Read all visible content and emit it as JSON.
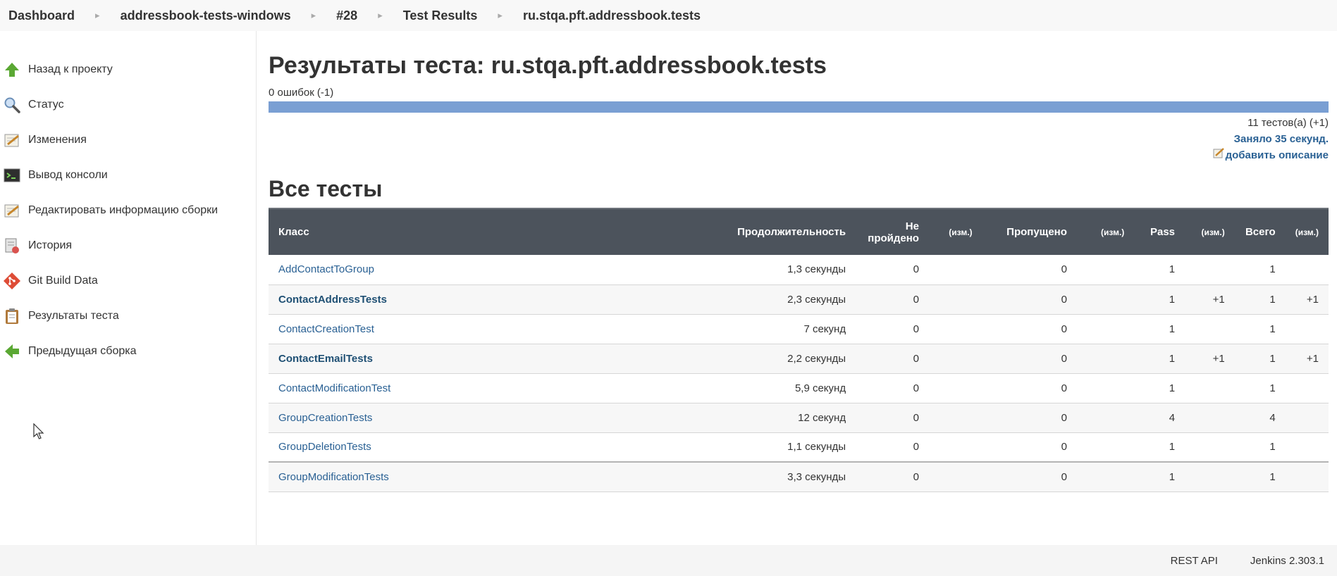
{
  "breadcrumbs": [
    {
      "label": "Dashboard"
    },
    {
      "label": "addressbook-tests-windows"
    },
    {
      "label": "#28"
    },
    {
      "label": "Test Results"
    },
    {
      "label": "ru.stqa.pft.addressbook.tests"
    }
  ],
  "sidebar": {
    "items": [
      {
        "label": "Назад к проекту",
        "icon": "arrow-up-icon"
      },
      {
        "label": "Статус",
        "icon": "magnifier-icon"
      },
      {
        "label": "Изменения",
        "icon": "notepad-icon"
      },
      {
        "label": "Вывод консоли",
        "icon": "terminal-icon"
      },
      {
        "label": "Редактировать информацию сборки",
        "icon": "notepad-icon"
      },
      {
        "label": "История",
        "icon": "history-icon"
      },
      {
        "label": "Git Build Data",
        "icon": "git-icon"
      },
      {
        "label": "Результаты теста",
        "icon": "clipboard-icon"
      },
      {
        "label": "Предыдущая сборка",
        "icon": "arrow-left-icon"
      }
    ]
  },
  "main": {
    "title": "Результаты теста: ru.stqa.pft.addressbook.tests",
    "failures": "0 ошибок (-1)",
    "progress_pass_fraction": 1.0,
    "tests_count": "11 тестов(а) (+1)",
    "duration": "Заняло 35 секунд.",
    "add_description": "добавить описание",
    "all_tests_title": "Все тесты"
  },
  "table": {
    "headers": {
      "class": "Класс",
      "duration": "Продолжительность",
      "failed": "Не пройдено",
      "change1": "(изм.)",
      "skipped": "Пропущено",
      "change2": "(изм.)",
      "pass": "Pass",
      "change3": "(изм.)",
      "total": "Всего",
      "change4": "(изм.)"
    },
    "rows": [
      {
        "cls": "AddContactToGroup",
        "duration": "1,3 секунды",
        "failed": "0",
        "fail_diff": "",
        "skipped": "0",
        "skip_diff": "",
        "pass": "1",
        "pass_diff": "",
        "total": "1",
        "total_diff": ""
      },
      {
        "cls": "ContactAddressTests",
        "duration": "2,3 секунды",
        "failed": "0",
        "fail_diff": "",
        "skipped": "0",
        "skip_diff": "",
        "pass": "1",
        "pass_diff": "+1",
        "total": "1",
        "total_diff": "+1"
      },
      {
        "cls": "ContactCreationTest",
        "duration": "7 секунд",
        "failed": "0",
        "fail_diff": "",
        "skipped": "0",
        "skip_diff": "",
        "pass": "1",
        "pass_diff": "",
        "total": "1",
        "total_diff": ""
      },
      {
        "cls": "ContactEmailTests",
        "duration": "2,2 секунды",
        "failed": "0",
        "fail_diff": "",
        "skipped": "0",
        "skip_diff": "",
        "pass": "1",
        "pass_diff": "+1",
        "total": "1",
        "total_diff": "+1"
      },
      {
        "cls": "ContactModificationTest",
        "duration": "5,9 секунд",
        "failed": "0",
        "fail_diff": "",
        "skipped": "0",
        "skip_diff": "",
        "pass": "1",
        "pass_diff": "",
        "total": "1",
        "total_diff": ""
      },
      {
        "cls": "GroupCreationTests",
        "duration": "12 секунд",
        "failed": "0",
        "fail_diff": "",
        "skipped": "0",
        "skip_diff": "",
        "pass": "4",
        "pass_diff": "",
        "total": "4",
        "total_diff": ""
      },
      {
        "cls": "GroupDeletionTests",
        "duration": "1,1 секунды",
        "failed": "0",
        "fail_diff": "",
        "skipped": "0",
        "skip_diff": "",
        "pass": "1",
        "pass_diff": "",
        "total": "1",
        "total_diff": ""
      },
      {
        "cls": "GroupModificationTests",
        "duration": "3,3 секунды",
        "failed": "0",
        "fail_diff": "",
        "skipped": "0",
        "skip_diff": "",
        "pass": "1",
        "pass_diff": "",
        "total": "1",
        "total_diff": ""
      }
    ]
  },
  "footer": {
    "rest_api": "REST API",
    "version": "Jenkins 2.303.1"
  },
  "colors": {
    "progress_pass": "#7a9fd3",
    "table_header": "#4c535c",
    "link": "#2a6194"
  }
}
